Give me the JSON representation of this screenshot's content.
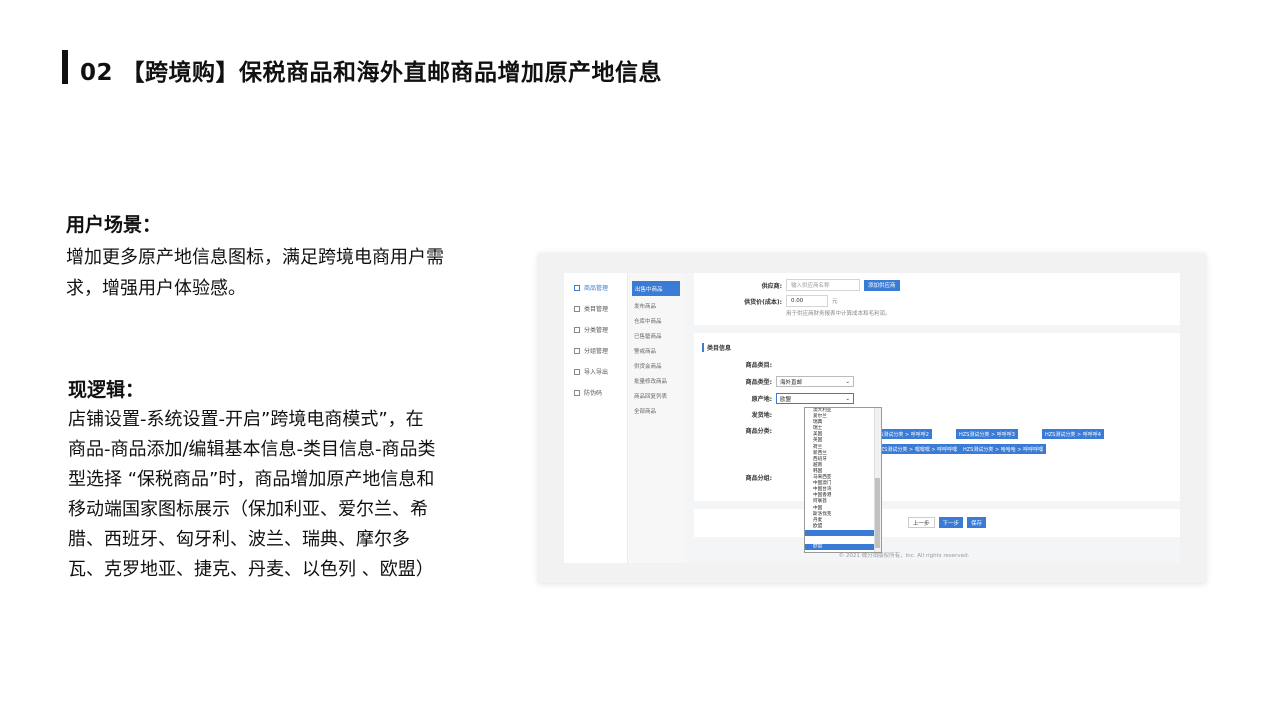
{
  "slide": {
    "title": "02 【跨境购】保税商品和海外直邮商品增加原产地信息",
    "scene_heading": "用户场景：",
    "scene_text": "增加更多原产地信息图标，满足跨境电商用户需求，增强用户体验感。",
    "logic_heading": "现逻辑：",
    "logic_text": "店铺设置-系统设置-开启”跨境电商模式”，在商品-商品添加/编辑基本信息-类目信息-商品类型选择 “保税商品”时，商品增加原产地信息和移动端国家图标展示（保加利亚、爱尔兰、希腊、西班牙、匈牙利、波兰、瑞典、摩尔多瓦、克罗地亚、捷克、丹麦、以色列 、欧盟）"
  },
  "app": {
    "sidebar": [
      {
        "label": "商品管理",
        "icon": "box-icon"
      },
      {
        "label": "类目管理",
        "icon": "list-icon"
      },
      {
        "label": "分类管理",
        "icon": "grid-icon"
      },
      {
        "label": "分组管理",
        "icon": "folder-icon"
      },
      {
        "label": "导入导出",
        "icon": "import-icon"
      },
      {
        "label": "防伪码",
        "icon": "tag-icon"
      }
    ],
    "subnav": [
      "出售中商品",
      "发布商品",
      "仓库中商品",
      "已售罄商品",
      "警戒商品",
      "供货会商品",
      "批量修改商品",
      "商品回复列表",
      "全部商品"
    ],
    "supplier_label": "供应商:",
    "supplier_placeholder": "输入供应商名称",
    "add_supplier_btn": "添加供应商",
    "cost_label": "供货价(成本):",
    "cost_value": "0.00",
    "cost_unit": "元",
    "cost_hint": "用于供应商财务报表中计算成本和毛利润。",
    "section_title": "类目信息",
    "category_label": "商品类目:",
    "type_label": "商品类型:",
    "type_value": "海外直邮",
    "origin_label": "原产地:",
    "origin_value": "欧盟",
    "ship_label": "发货地:",
    "cls_label": "商品分类:",
    "group_label": "商品分组:",
    "chips_row1": [
      "HZS测试分类 > 呼呼呼2",
      "HZS测试分类 > 呼呼呼3",
      "HZS测试分类 > 呼呼呼4"
    ],
    "chips_row2": [
      "HZS测试分类 > 嘿嘿嘿 > 呼呼呼嘿",
      "HZS测试分类 > 哈哈哈 > 呼呼呼嘿"
    ],
    "origin_options": [
      "澳大利亚",
      "爱尔兰",
      "瑞典",
      "瑞士",
      "美国",
      "英国",
      "荷兰",
      "新西兰",
      "西班牙",
      "越南",
      "韩国",
      "马来西亚",
      "中国澳门",
      "中国台湾",
      "中国香港",
      "阿联酋",
      "中国",
      "斯洛伐克",
      "丹麦",
      "欧盟"
    ],
    "prev_btn": "上一步",
    "next_btn": "下一步",
    "save_btn": "保存",
    "footer": "© 2021 微分销版权所有，Inc. All rights reserved.",
    "accent_color": "#3a7bd5"
  }
}
